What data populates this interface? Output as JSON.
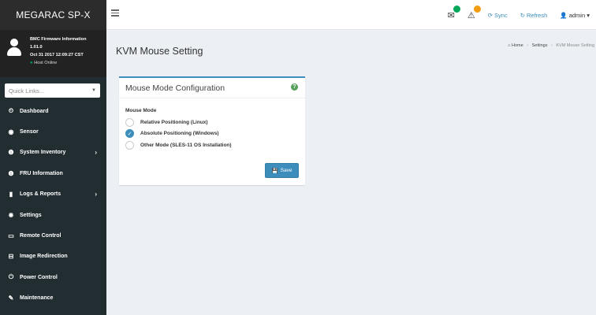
{
  "sidebar": {
    "brand": "MEGARAC SP-X",
    "user": {
      "title": "BMC Firmware Information",
      "version": "1.01.0",
      "datetime": "Oct 31 2017 12:09:27 CST",
      "status": "Host Online"
    },
    "quick_links": {
      "placeholder": "Quick Links..."
    },
    "items": [
      {
        "label": "Dashboard",
        "icon": "tachometer-icon",
        "glyph": "⏲"
      },
      {
        "label": "Sensor",
        "icon": "sensor-gauge-icon",
        "glyph": "◉"
      },
      {
        "label": "System Inventory",
        "icon": "info-circle-icon",
        "glyph": "❶",
        "has_submenu": true
      },
      {
        "label": "FRU Information",
        "icon": "info-circle-icon",
        "glyph": "❶"
      },
      {
        "label": "Logs & Reports",
        "icon": "bar-chart-icon",
        "glyph": "▮",
        "has_submenu": true
      },
      {
        "label": "Settings",
        "icon": "gear-icon",
        "glyph": "✹"
      },
      {
        "label": "Remote Control",
        "icon": "monitor-icon",
        "glyph": "▭"
      },
      {
        "label": "Image Redirection",
        "icon": "drive-icon",
        "glyph": "⊟"
      },
      {
        "label": "Power Control",
        "icon": "power-icon",
        "glyph": "⏻"
      },
      {
        "label": "Maintenance",
        "icon": "wrench-icon",
        "glyph": "✎"
      }
    ]
  },
  "topbar": {
    "sync_label": "Sync",
    "refresh_label": "Refresh",
    "user_label": "admin",
    "colors": {
      "mail_badge": "#00a65a",
      "alert_badge": "#f39c12",
      "link": "#3c8dbc"
    }
  },
  "page": {
    "title": "KVM Mouse Setting",
    "breadcrumb": {
      "home": "Home",
      "settings": "Settings",
      "current": "KVM Mouse Setting"
    }
  },
  "box": {
    "title": "Mouse Mode Configuration",
    "field_label": "Mouse Mode",
    "options": [
      {
        "label": "Relative Positioning (Linux)",
        "selected": false
      },
      {
        "label": "Absolute Positioning (Windows)",
        "selected": true
      },
      {
        "label": "Other Mode (SLES-11 OS Installation)",
        "selected": false
      }
    ],
    "save_label": "Save"
  },
  "colors": {
    "sidebar_bg": "#222d32",
    "accent": "#3c8dbc",
    "content_bg": "#ecf0f5"
  }
}
